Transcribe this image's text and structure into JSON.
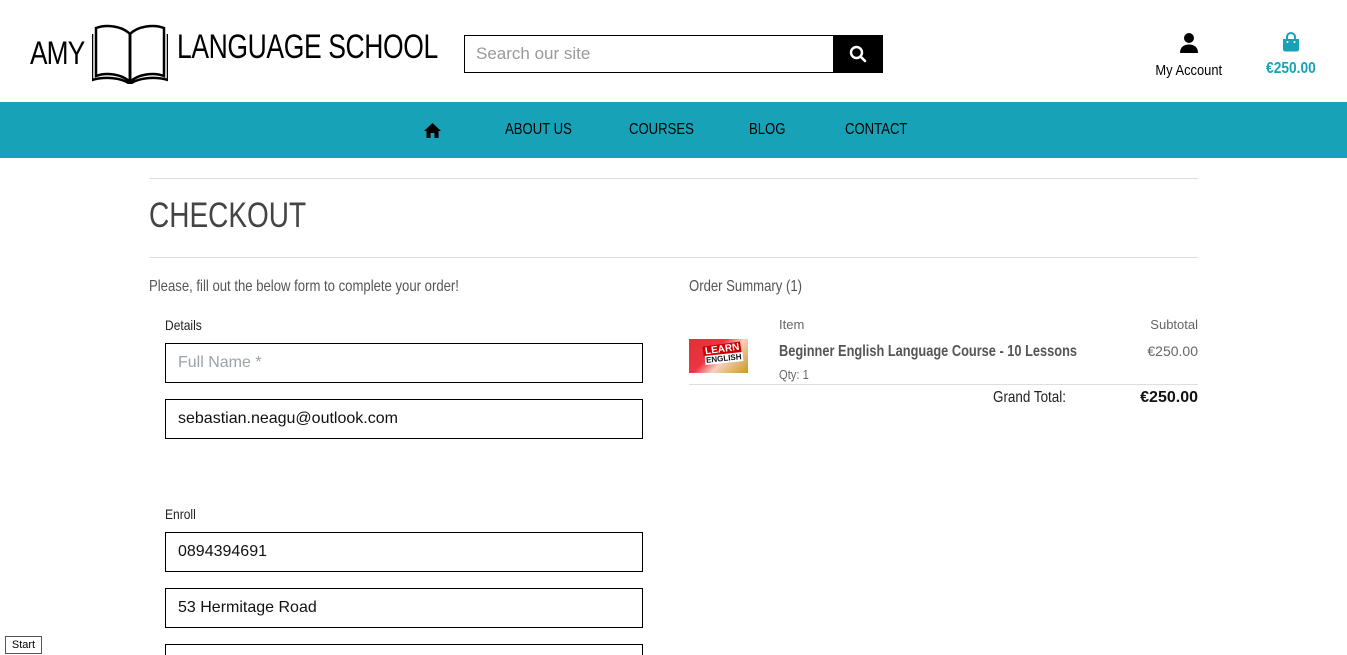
{
  "header": {
    "logo_left": "AMY",
    "logo_right": "LANGUAGE SCHOOL",
    "search_placeholder": "Search our site",
    "account_label": "My Account",
    "cart_total": "€250.00",
    "accent_color": "#17a2b8"
  },
  "nav": {
    "home_icon": "home-icon",
    "items": [
      "ABOUT US",
      "COURSES",
      "BLOG",
      "CONTACT"
    ]
  },
  "page": {
    "title": "CHECKOUT",
    "lead": "Please, fill out the below form to complete your order!"
  },
  "form": {
    "details_label": "Details",
    "full_name_placeholder": "Full Name *",
    "email_value": "sebastian.neagu@outlook.com",
    "enroll_label": "Enroll",
    "phone_value": "0894394691",
    "address_value": "53 Hermitage Road",
    "next_field_value": ""
  },
  "summary": {
    "title": "Order Summary (1)",
    "col_item": "Item",
    "col_subtotal": "Subtotal",
    "item_name": "Beginner English Language Course - 10 Lessons",
    "item_qty": "Qty: 1",
    "item_subtotal": "€250.00",
    "thumb_text_1": "LEARN",
    "thumb_text_2": "ENGLISH",
    "grand_total_label": "Grand Total:",
    "grand_total_value": "€250.00"
  },
  "taskbar": {
    "start_label": "Start"
  }
}
